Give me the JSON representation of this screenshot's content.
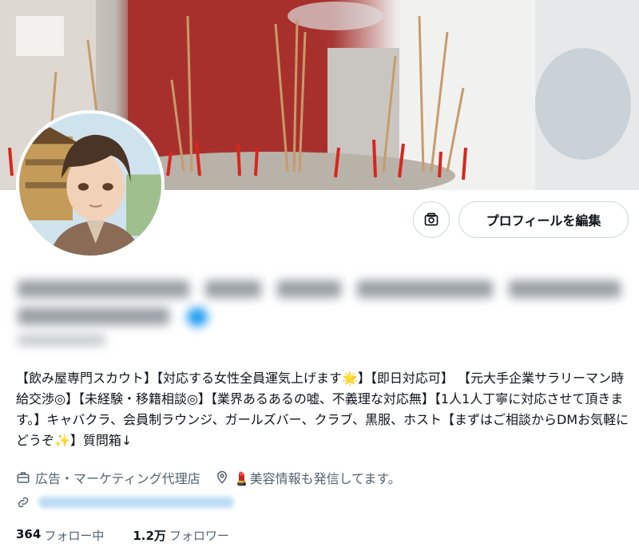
{
  "profile": {
    "edit_button_label": "プロフィールを編集",
    "bio": "【飲み屋専門スカウト】【対応する女性全員運気上げます🌟】【即日対応可】 【元大手企業サラリーマン時給交渉◎】【未経験・移籍相談◎】【業界あるあるの嘘、不義理な対応無】【1人1人丁寧に対応させて頂きます。】キャバクラ、会員制ラウンジ、ガールズバー、クラブ、黒服、ホスト【まずはご相談からDMお気軽にどうぞ✨】質問箱↓",
    "category": "広告・マーケティング代理店",
    "location": "💄美容情報も発信してます。",
    "following_count": "364",
    "following_label": "フォロー中",
    "followers_count": "1.2万",
    "followers_label": "フォロワー"
  },
  "icons": {
    "edit_photo": "photo-edit-icon",
    "category": "briefcase-icon",
    "location": "location-pin-icon",
    "link": "link-icon"
  },
  "colors": {
    "text_primary": "#0f1419",
    "text_secondary": "#536471",
    "border": "#cfd9de"
  }
}
